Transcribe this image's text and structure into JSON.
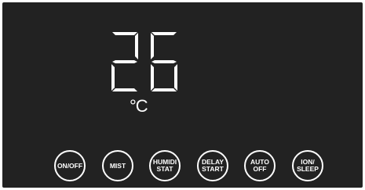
{
  "display": {
    "digits": "26",
    "unit": "°C"
  },
  "buttons": {
    "on_off": {
      "line1": "ON/OFF",
      "line2": ""
    },
    "mist": {
      "line1": "MIST",
      "line2": ""
    },
    "humidistat": {
      "line1": "HUMIDI",
      "line2": "STAT"
    },
    "delay_start": {
      "line1": "DELAY",
      "line2": "START"
    },
    "auto_off": {
      "line1": "AUTO",
      "line2": "OFF"
    },
    "ion_sleep": {
      "line1": "ION/",
      "line2": "SLEEP"
    }
  },
  "colors": {
    "panel": "#222222",
    "foreground": "#ffffff"
  }
}
